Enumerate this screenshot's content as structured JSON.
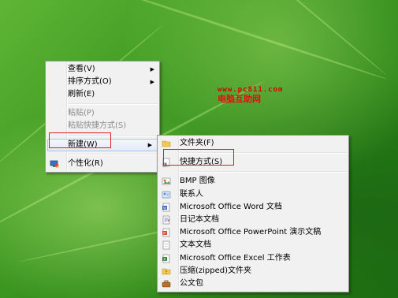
{
  "watermark": {
    "url": "www.pc811.com",
    "name": "电脑互助网"
  },
  "context_menu": {
    "items": [
      {
        "label": "查看(V)",
        "submenu": true
      },
      {
        "label": "排序方式(O)",
        "submenu": true
      },
      {
        "label": "刷新(E)"
      },
      {
        "label": "粘贴(P)",
        "disabled": true
      },
      {
        "label": "粘贴快捷方式(S)",
        "disabled": true
      },
      {
        "label": "新建(W)",
        "submenu": true
      },
      {
        "label": "个性化(R)",
        "icon": "personalize-icon"
      }
    ]
  },
  "new_submenu": {
    "items": [
      {
        "label": "文件夹(F)",
        "icon": "folder-icon"
      },
      {
        "label": "快捷方式(S)",
        "icon": "shortcut-icon"
      },
      {
        "label": "BMP 图像",
        "icon": "bitmap-image-icon"
      },
      {
        "label": "联系人",
        "icon": "contact-icon"
      },
      {
        "label": "Microsoft Office Word 文档",
        "icon": "word-document-icon"
      },
      {
        "label": "日记本文档",
        "icon": "journal-document-icon"
      },
      {
        "label": "Microsoft Office PowerPoint 演示文稿",
        "icon": "powerpoint-presentation-icon"
      },
      {
        "label": "文本文档",
        "icon": "text-document-icon"
      },
      {
        "label": "Microsoft Office Excel 工作表",
        "icon": "excel-worksheet-icon"
      },
      {
        "label": "压缩(zipped)文件夹",
        "icon": "zip-folder-icon"
      },
      {
        "label": "公文包",
        "icon": "briefcase-icon"
      }
    ]
  },
  "colors": {
    "desktop": "#3f9a22",
    "menu_bg": "#f1f1f1",
    "highlight_box": "#e02020",
    "watermark": "#d60000"
  }
}
